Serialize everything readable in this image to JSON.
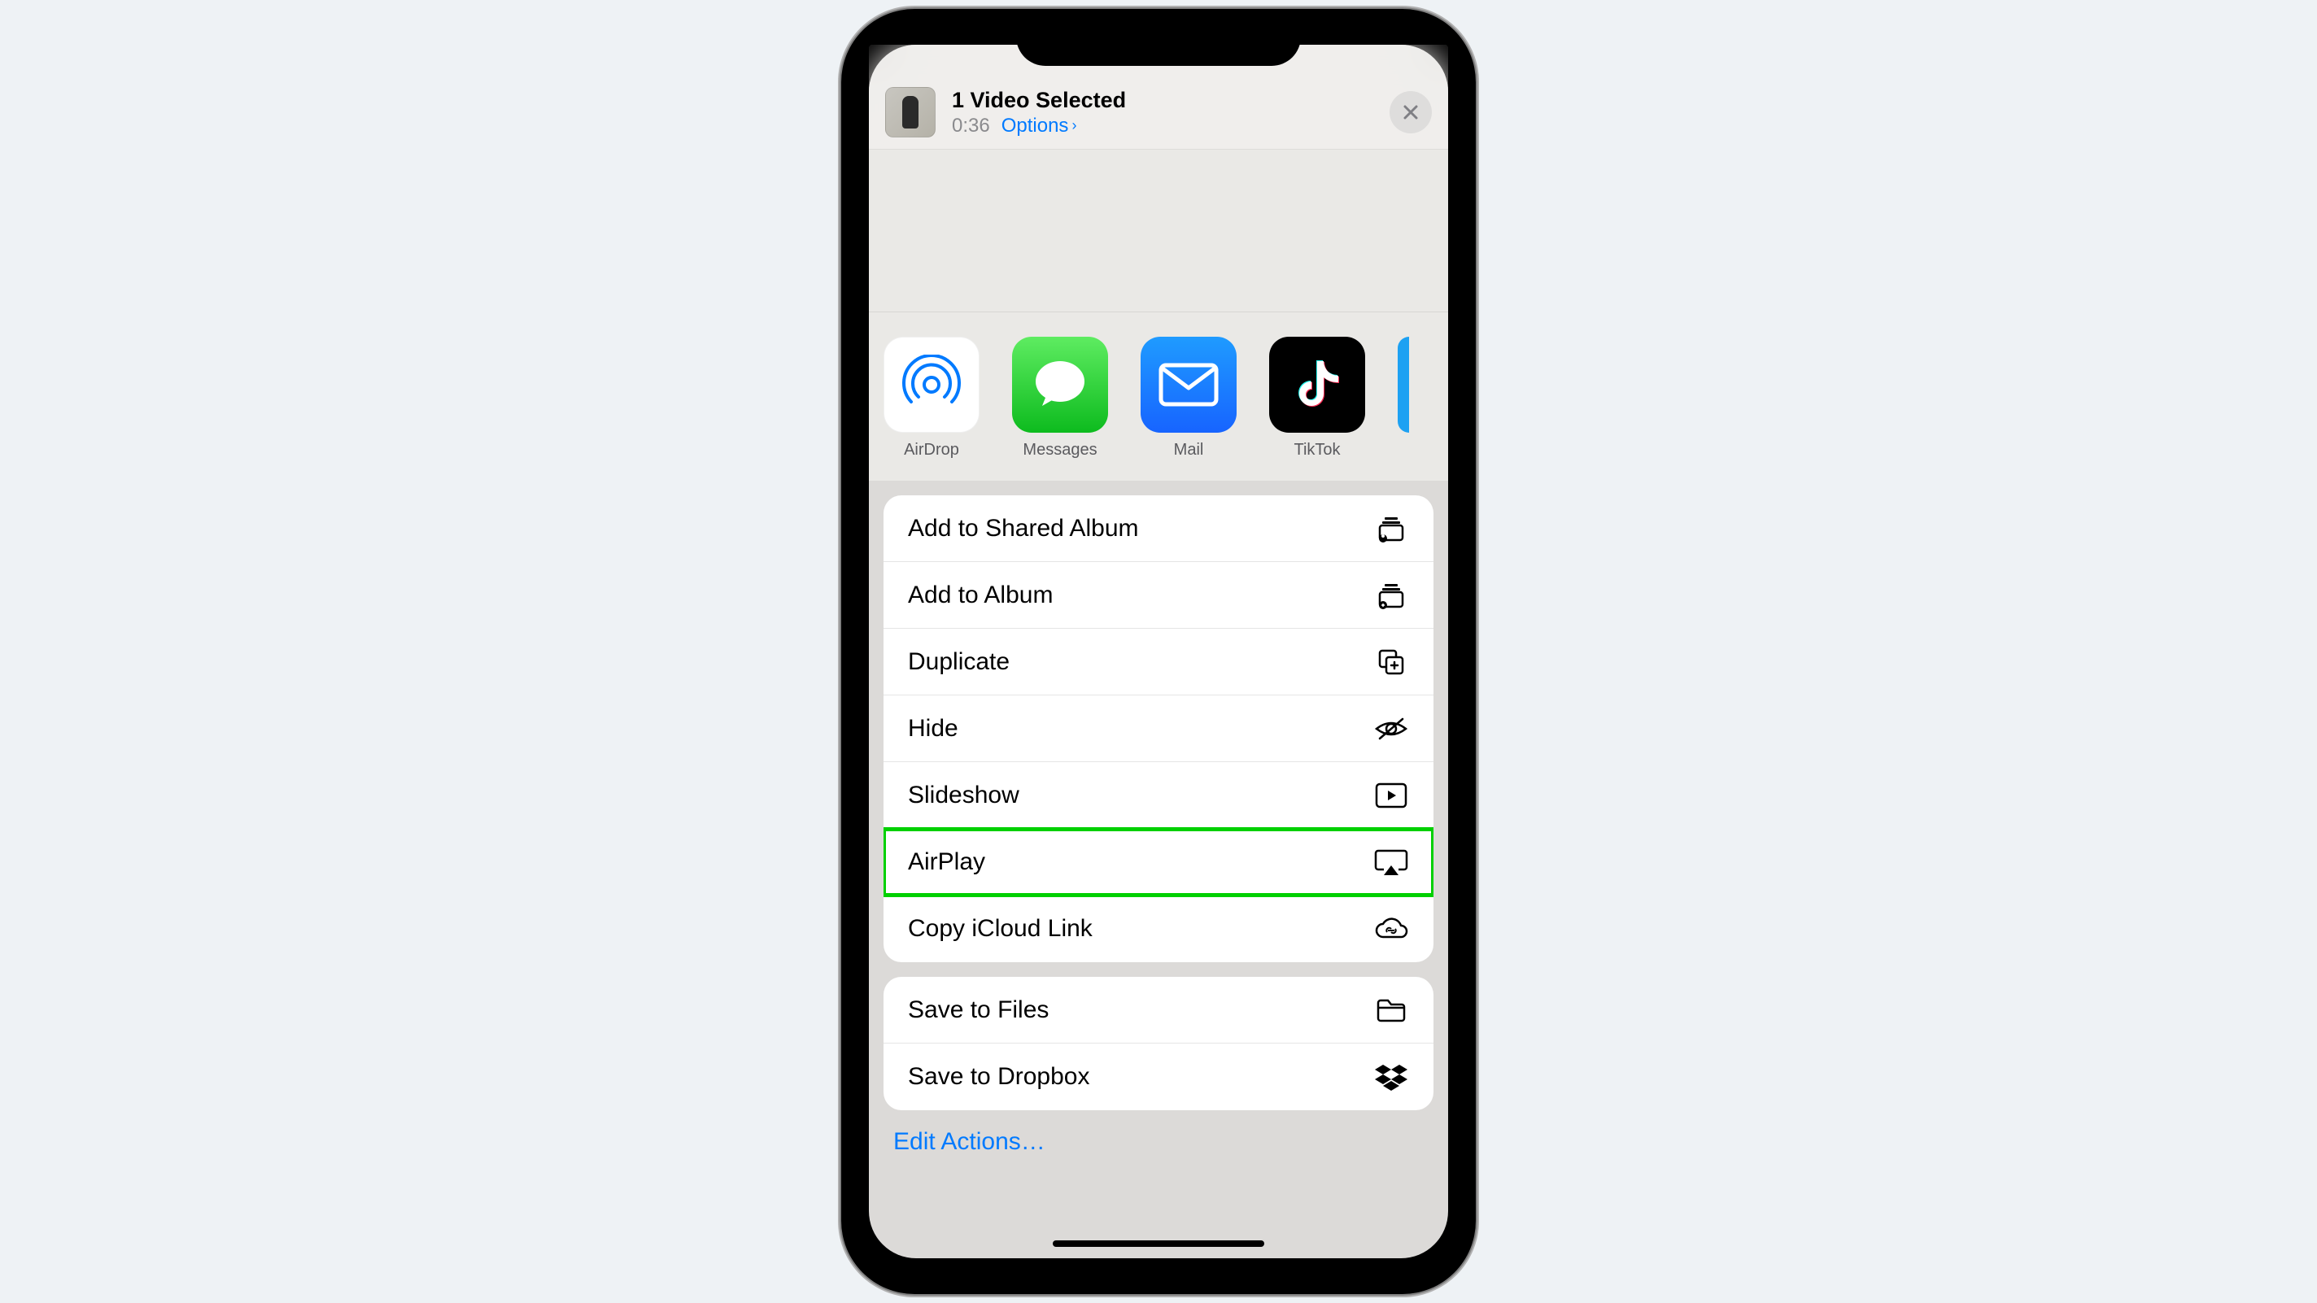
{
  "header": {
    "title": "1 Video Selected",
    "duration": "0:36",
    "options_label": "Options"
  },
  "apps": [
    {
      "name": "airdrop",
      "label": "AirDrop"
    },
    {
      "name": "messages",
      "label": "Messages"
    },
    {
      "name": "mail",
      "label": "Mail"
    },
    {
      "name": "tiktok",
      "label": "TikTok"
    }
  ],
  "action_group_1": [
    {
      "label": "Add to Shared Album",
      "icon": "shared-album"
    },
    {
      "label": "Add to Album",
      "icon": "album"
    },
    {
      "label": "Duplicate",
      "icon": "duplicate"
    },
    {
      "label": "Hide",
      "icon": "hide"
    },
    {
      "label": "Slideshow",
      "icon": "slideshow"
    },
    {
      "label": "AirPlay",
      "icon": "airplay",
      "highlighted": true
    },
    {
      "label": "Copy iCloud Link",
      "icon": "icloud-link"
    }
  ],
  "action_group_2": [
    {
      "label": "Save to Files",
      "icon": "files"
    },
    {
      "label": "Save to Dropbox",
      "icon": "dropbox"
    }
  ],
  "edit_actions_label": "Edit Actions…"
}
